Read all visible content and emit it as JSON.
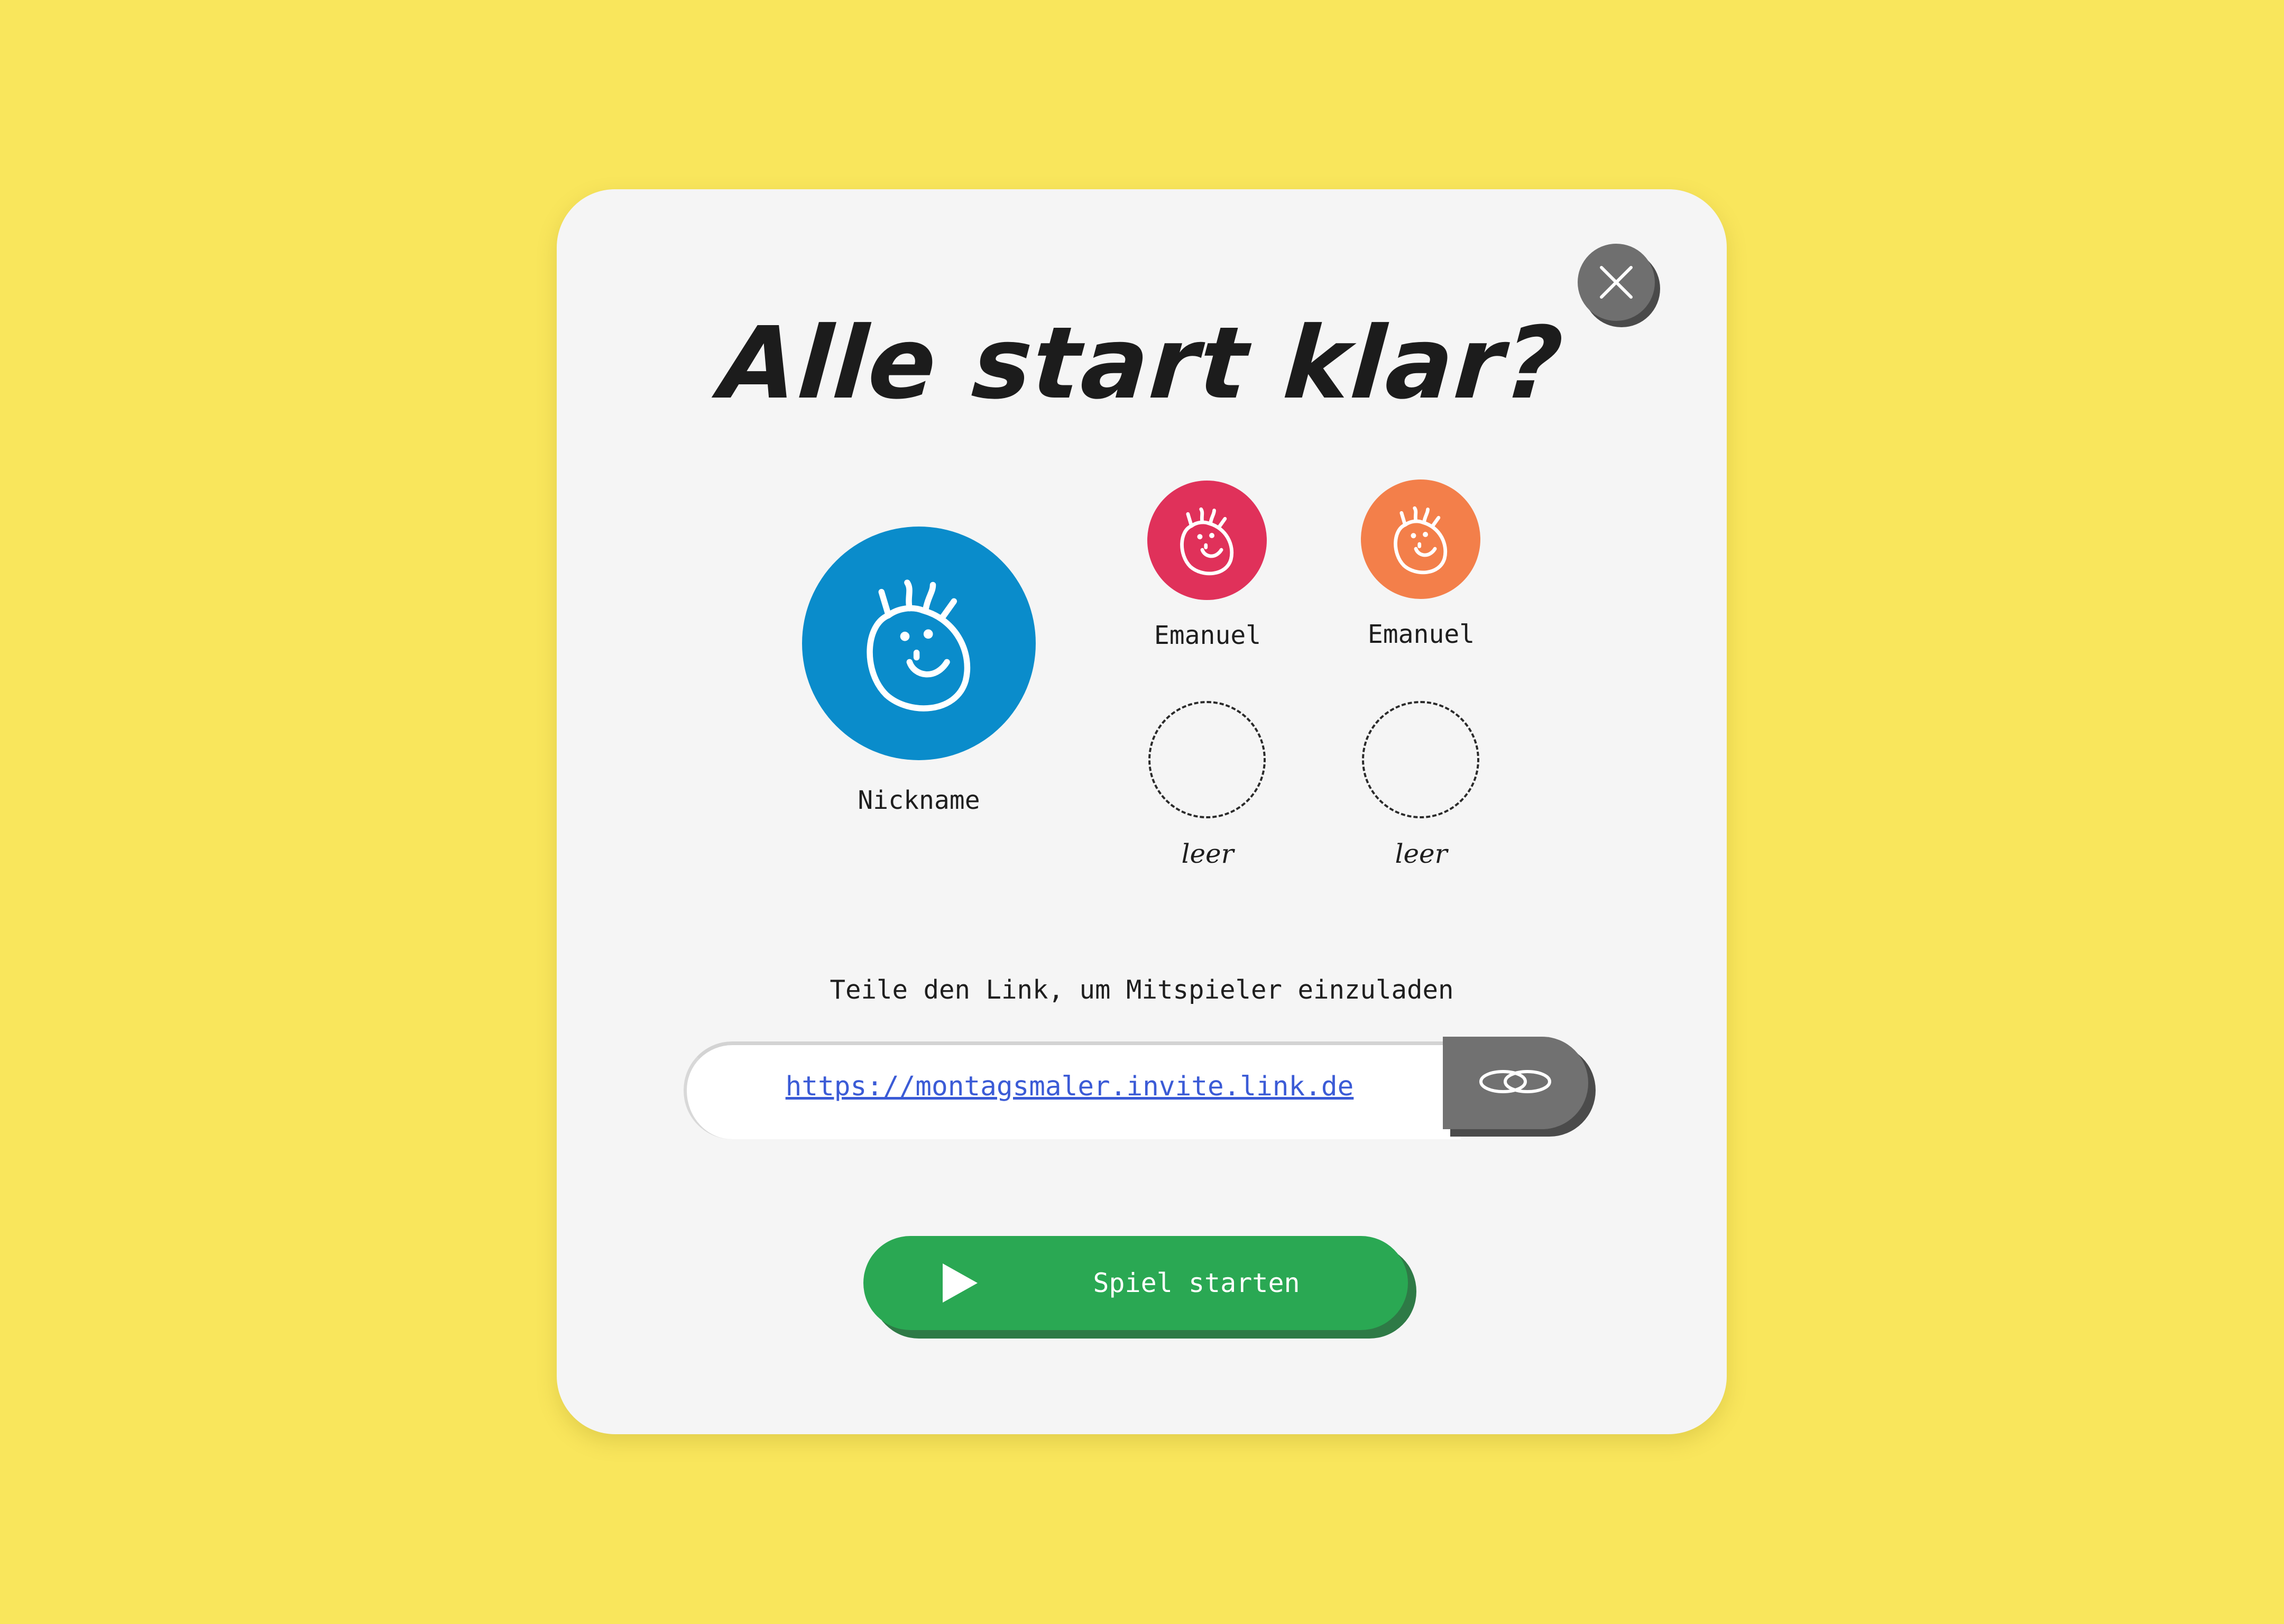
{
  "dialog": {
    "title": "Alle start klar?",
    "close_icon": "close-icon"
  },
  "players": {
    "host": {
      "name": "Nickname",
      "color": "#0a8ccb",
      "icon": "smiley-face-icon"
    },
    "others": [
      {
        "name": "Emanuel",
        "color": "#e0315a",
        "icon": "smiley-face-icon"
      },
      {
        "name": "Emanuel",
        "color": "#f37f4a",
        "icon": "smiley-face-icon"
      }
    ],
    "empty_slots": [
      {
        "label": "leer"
      },
      {
        "label": "leer"
      }
    ]
  },
  "invite": {
    "instruction": "Teile den Link, um Mitspieler einzuladen",
    "link": "https://montagsmaler.invite.link.de",
    "copy_icon": "link-chain-icon"
  },
  "start_button": {
    "label": "Spiel starten",
    "icon": "play-icon",
    "color": "#2aa853"
  }
}
